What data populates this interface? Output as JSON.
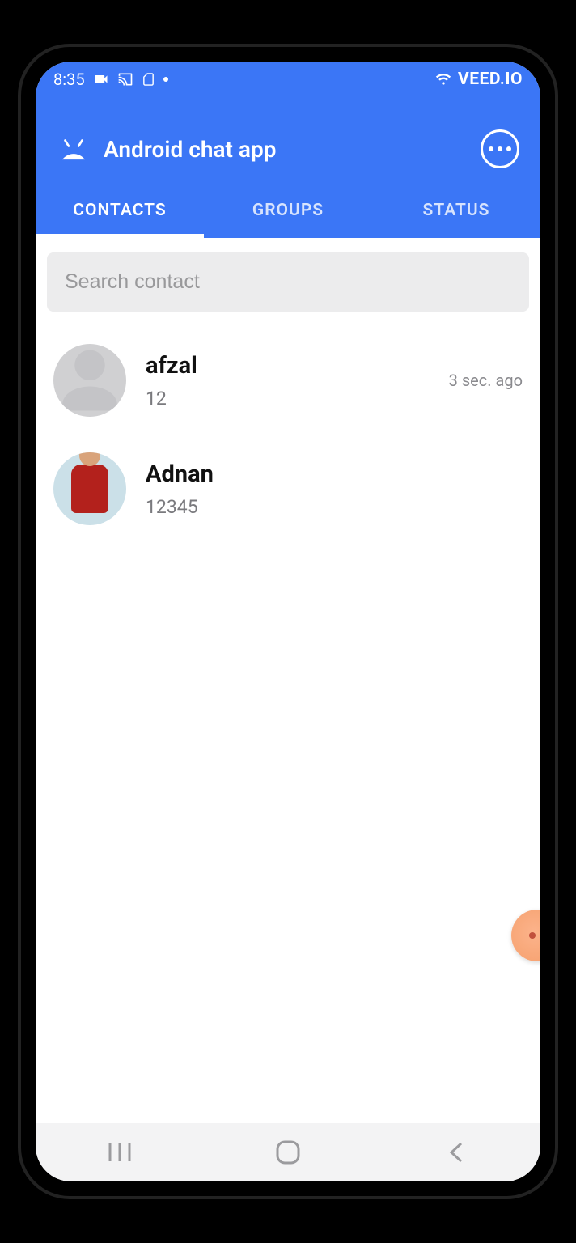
{
  "status_bar": {
    "time": "8:35",
    "brand_overlay": "VEED.IO"
  },
  "app_bar": {
    "title": "Android chat app"
  },
  "tabs": [
    {
      "label": "CONTACTS",
      "active": true
    },
    {
      "label": "GROUPS",
      "active": false
    },
    {
      "label": "STATUS",
      "active": false
    }
  ],
  "search": {
    "placeholder": "Search contact",
    "value": ""
  },
  "contacts": [
    {
      "name": "afzal",
      "subtitle": "12",
      "time": "3 sec. ago",
      "has_photo": false
    },
    {
      "name": "Adnan",
      "subtitle": "12345",
      "time": "",
      "has_photo": true
    }
  ],
  "colors": {
    "primary": "#3b76f6",
    "search_bg": "#ececed",
    "text_secondary": "#7a7a7e"
  }
}
